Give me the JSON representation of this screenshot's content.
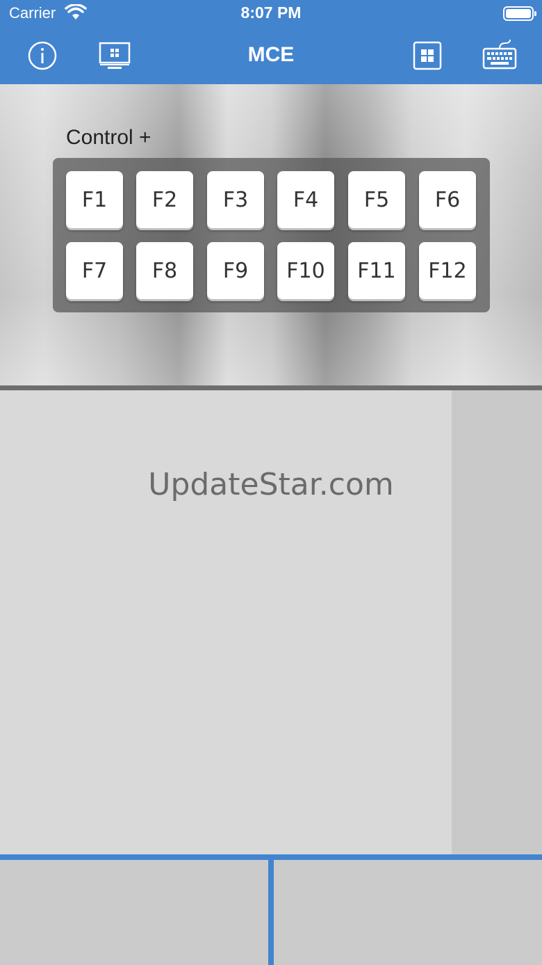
{
  "status_bar": {
    "carrier": "Carrier",
    "time": "8:07 PM"
  },
  "nav": {
    "title": "MCE",
    "icons": [
      "info-icon",
      "monitor-icon",
      "windows-grid-icon",
      "keyboard-icon"
    ]
  },
  "panel": {
    "modifier_label": "Control +",
    "keys": [
      "F1",
      "F2",
      "F3",
      "F4",
      "F5",
      "F6",
      "F7",
      "F8",
      "F9",
      "F10",
      "F11",
      "F12"
    ]
  },
  "trackpad": {
    "watermark": "UpdateStar.com"
  },
  "colors": {
    "accent": "#4384cf",
    "trackpad": "#d9d9d9",
    "mouse_buttons": "#cbcbcb"
  }
}
